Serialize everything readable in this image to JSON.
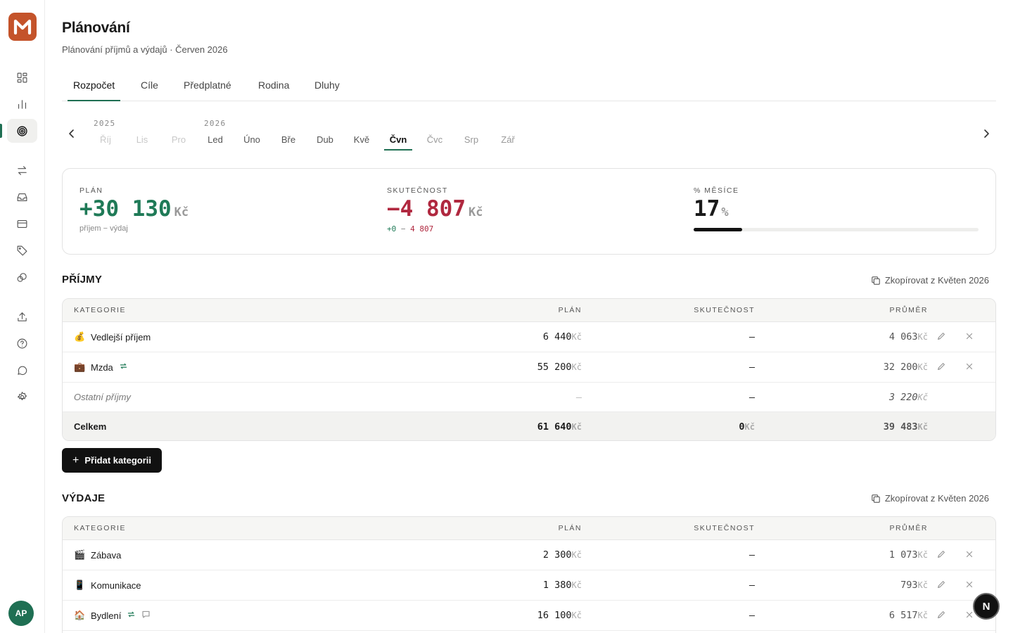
{
  "app": {
    "logo_letter": "M",
    "avatar_initials": "AP",
    "brand_color": "#c4532a",
    "accent_color": "#1f6f53"
  },
  "sidebar": {
    "items": [
      {
        "icon": "dashboard-grid-icon"
      },
      {
        "icon": "bar-chart-icon"
      },
      {
        "icon": "target-icon",
        "active": true
      },
      {
        "icon": "transfer-arrows-icon"
      },
      {
        "icon": "inbox-icon"
      },
      {
        "icon": "credit-card-icon"
      },
      {
        "icon": "tag-icon"
      },
      {
        "icon": "coins-icon"
      },
      {
        "icon": "upload-icon"
      },
      {
        "icon": "help-circle-icon"
      },
      {
        "icon": "chat-bubble-icon"
      },
      {
        "icon": "settings-gear-icon"
      }
    ]
  },
  "header": {
    "title": "Plánování",
    "subtitle": "Plánování příjmů a výdajů · Červen 2026"
  },
  "tabs": [
    {
      "label": "Rozpočet",
      "active": true
    },
    {
      "label": "Cíle"
    },
    {
      "label": "Předplatné"
    },
    {
      "label": "Rodina"
    },
    {
      "label": "Dluhy"
    }
  ],
  "months": {
    "years": [
      "2025",
      "2026"
    ],
    "items": [
      {
        "label": "Říj",
        "state": "faded"
      },
      {
        "label": "Lis",
        "state": "faded"
      },
      {
        "label": "Pro",
        "state": "faded"
      },
      {
        "label": "Led",
        "state": "normal"
      },
      {
        "label": "Úno",
        "state": "normal"
      },
      {
        "label": "Bře",
        "state": "normal"
      },
      {
        "label": "Dub",
        "state": "normal"
      },
      {
        "label": "Kvě",
        "state": "normal"
      },
      {
        "label": "Čvn",
        "state": "active"
      },
      {
        "label": "Čvc",
        "state": "dim"
      },
      {
        "label": "Srp",
        "state": "dim"
      },
      {
        "label": "Zář",
        "state": "dim"
      }
    ]
  },
  "summary": {
    "plan": {
      "label": "PLÁN",
      "value": "+30 130",
      "unit": "Kč",
      "note": "příjem − výdaj"
    },
    "actual": {
      "label": "SKUTEČNOST",
      "value": "−4 807",
      "unit": "Kč",
      "note_income": "+0",
      "note_sep": " − ",
      "note_expense": "4 807"
    },
    "month_pct": {
      "label": "% MĚSÍCE",
      "value": "17",
      "unit": "%",
      "progress": 0.17
    }
  },
  "income": {
    "title": "PŘÍJMY",
    "copy_label": "Zkopírovat z Květen 2026",
    "headers": {
      "category": "KATEGORIE",
      "plan": "PLÁN",
      "actual": "SKUTEČNOST",
      "avg": "PRŮMĚR"
    },
    "rows": [
      {
        "emoji": "💰",
        "name": "Vedlejší příjem",
        "plan": "6 440",
        "actual": "–",
        "avg": "4 063",
        "recurring": false
      },
      {
        "emoji": "💼",
        "name": "Mzda",
        "plan": "55 200",
        "actual": "–",
        "avg": "32 200",
        "recurring": true
      },
      {
        "name": "Ostatní příjmy",
        "plan": "–",
        "actual": "–",
        "avg": "3 220",
        "other": true
      }
    ],
    "total": {
      "label": "Celkem",
      "plan": "61 640",
      "actual": "0",
      "avg": "39 483"
    },
    "unit": "Kč",
    "add_label": "Přidat kategorii"
  },
  "expenses": {
    "title": "VÝDAJE",
    "copy_label": "Zkopírovat z Květen 2026",
    "headers": {
      "category": "KATEGORIE",
      "plan": "PLÁN",
      "actual": "SKUTEČNOST",
      "avg": "PRŮMĚR"
    },
    "rows": [
      {
        "emoji": "🎬",
        "name": "Zábava",
        "plan": "2 300",
        "actual": "–",
        "avg": "1 073"
      },
      {
        "emoji": "📱",
        "name": "Komunikace",
        "plan": "1 380",
        "actual": "–",
        "avg": "793"
      },
      {
        "emoji": "🏠",
        "name": "Bydlení",
        "plan": "16 100",
        "actual": "–",
        "avg": "6 517",
        "recurring": true,
        "note": true
      }
    ],
    "unit": "Kč"
  },
  "fab": {
    "label": "N"
  }
}
